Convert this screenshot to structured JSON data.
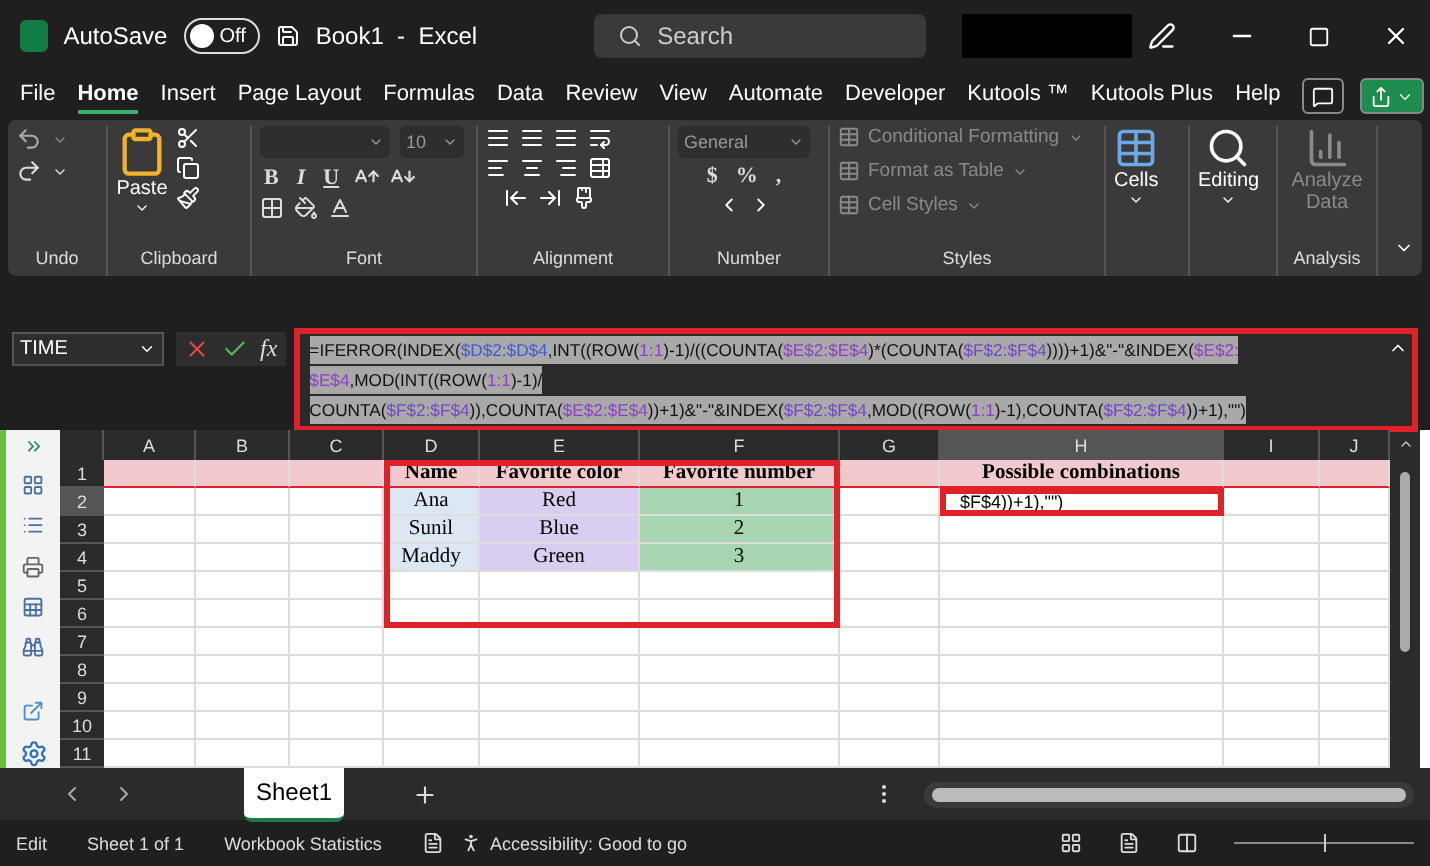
{
  "title_bar": {
    "autosave_label": "AutoSave",
    "autosave_toggle": {
      "on": false,
      "label": "Off"
    },
    "document_title": "Book1  -  Excel",
    "search": {
      "placeholder": "Search"
    }
  },
  "menu_tabs": [
    {
      "label": "File",
      "selected": false
    },
    {
      "label": "Home",
      "selected": true
    },
    {
      "label": "Insert",
      "selected": false
    },
    {
      "label": "Page Layout",
      "selected": false
    },
    {
      "label": "Formulas",
      "selected": false
    },
    {
      "label": "Data",
      "selected": false
    },
    {
      "label": "Review",
      "selected": false
    },
    {
      "label": "View",
      "selected": false
    },
    {
      "label": "Automate",
      "selected": false
    },
    {
      "label": "Developer",
      "selected": false
    },
    {
      "label": "Kutools ™",
      "selected": false
    },
    {
      "label": "Kutools Plus",
      "selected": false
    },
    {
      "label": "Help",
      "selected": false
    }
  ],
  "ribbon": {
    "undo": {
      "label": "Undo"
    },
    "clipboard": {
      "label": "Clipboard",
      "paste": "Paste"
    },
    "font": {
      "label": "Font",
      "size": "10",
      "bold": "B",
      "italic": "I",
      "underline": "U"
    },
    "alignment": {
      "label": "Alignment"
    },
    "number": {
      "label": "Number",
      "format": "General",
      "currency": "$",
      "percent": "%",
      "comma": ","
    },
    "styles": {
      "label": "Styles",
      "items": [
        {
          "label": "Conditional Formatting",
          "disabled": true
        },
        {
          "label": "Format as Table",
          "disabled": true
        },
        {
          "label": "Cell Styles",
          "disabled": true
        }
      ]
    },
    "cells": {
      "label": "Cells"
    },
    "editing": {
      "label": "Editing"
    },
    "analysis": {
      "label": "Analysis",
      "button": {
        "label": "Analyze Data",
        "disabled": true
      }
    }
  },
  "formula_bar": {
    "name_box": "TIME",
    "fx": "fx",
    "lines": [
      [
        {
          "text": "=IFERROR(INDEX("
        },
        {
          "text": "$D$2:$D$4",
          "color": "#3d5bd9"
        },
        {
          "text": ",INT((ROW("
        },
        {
          "text": "1:1",
          "color": "#8e3fc4"
        },
        {
          "text": ")-1)/((COUNTA("
        },
        {
          "text": "$E$2:$E$4",
          "color": "#8e3fc4"
        },
        {
          "text": ")*(COUNTA("
        },
        {
          "text": "$F$2:$F$4",
          "color": "#7446c6"
        },
        {
          "text": "))))+1)&\"-\"&INDEX("
        },
        {
          "text": "$E$2:",
          "color": "#8e3fc4"
        }
      ],
      [
        {
          "text": "$E$4",
          "color": "#8e3fc4"
        },
        {
          "text": ",MOD(INT((ROW("
        },
        {
          "text": "1:1",
          "color": "#8e3fc4"
        },
        {
          "text": ")-1)/"
        }
      ],
      [
        {
          "text": "COUNTA("
        },
        {
          "text": "$F$2:$F$4",
          "color": "#7446c6"
        },
        {
          "text": ")),COUNTA("
        },
        {
          "text": "$E$2:$E$4",
          "color": "#8e3fc4"
        },
        {
          "text": "))+1)&\"-\"&INDEX("
        },
        {
          "text": "$F$2:$F$4",
          "color": "#7446c6"
        },
        {
          "text": ",MOD((ROW("
        },
        {
          "text": "1:1",
          "color": "#8e3fc4"
        },
        {
          "text": ")-1),COUNTA("
        },
        {
          "text": "$F$2:$F$4",
          "color": "#7446c6"
        },
        {
          "text": "))+1),\"\")"
        }
      ]
    ]
  },
  "sheet": {
    "columns": [
      {
        "label": "A",
        "selected": false
      },
      {
        "label": "B",
        "selected": false
      },
      {
        "label": "C",
        "selected": false
      },
      {
        "label": "D",
        "selected": false
      },
      {
        "label": "E",
        "selected": false
      },
      {
        "label": "F",
        "selected": false
      },
      {
        "label": "G",
        "selected": false
      },
      {
        "label": "H",
        "selected": true
      },
      {
        "label": "I",
        "selected": false
      },
      {
        "label": "J",
        "selected": false
      }
    ],
    "rows": [
      {
        "label": "1",
        "selected": false
      },
      {
        "label": "2",
        "selected": true
      },
      {
        "label": "3",
        "selected": false
      },
      {
        "label": "4",
        "selected": false
      },
      {
        "label": "5",
        "selected": false
      },
      {
        "label": "6",
        "selected": false
      },
      {
        "label": "7",
        "selected": false
      },
      {
        "label": "8",
        "selected": false
      },
      {
        "label": "9",
        "selected": false
      },
      {
        "label": "10",
        "selected": false
      },
      {
        "label": "11",
        "selected": false
      }
    ],
    "table": {
      "columns": [
        {
          "label": "Name",
          "color": "#dde7f3"
        },
        {
          "label": "Favorite color",
          "color": "#d9cdf0"
        },
        {
          "label": "Favorite number",
          "color": "#a8d5b1"
        }
      ],
      "rows": [
        [
          "Ana",
          "Red",
          "1"
        ],
        [
          "Sunil",
          "Blue",
          "2"
        ],
        [
          "Maddy",
          "Green",
          "3"
        ]
      ]
    },
    "result": {
      "heading": "Possible combinations",
      "active_cell": "$F$4))+1),\"\")"
    }
  },
  "sheet_tabs": [
    {
      "label": "Sheet1",
      "selected": true
    }
  ],
  "status_bar": {
    "mode": "Edit",
    "sheet": "Sheet 1 of 1",
    "statistics": "Workbook Statistics",
    "accessibility": "Accessibility: Good to go",
    "zoom": {
      "level": 0.5
    }
  }
}
